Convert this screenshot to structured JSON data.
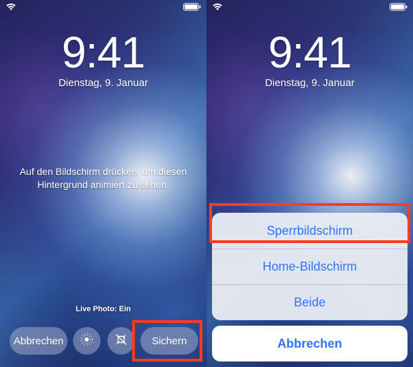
{
  "left": {
    "time": "9:41",
    "date": "Dienstag, 9. Januar",
    "hint_line1": "Auf den Bildschirm drücken, um diesen",
    "hint_line2": "Hintergrund animiert zu sehen.",
    "live_photo_label": "Live Photo: Ein",
    "cancel_label": "Abbrechen",
    "save_label": "Sichern"
  },
  "right": {
    "time": "9:41",
    "date": "Dienstag, 9. Januar",
    "sheet": {
      "option_lock": "Sperrbildschirm",
      "option_home": "Home-Bildschirm",
      "option_both": "Beide",
      "cancel": "Abbrechen"
    }
  }
}
